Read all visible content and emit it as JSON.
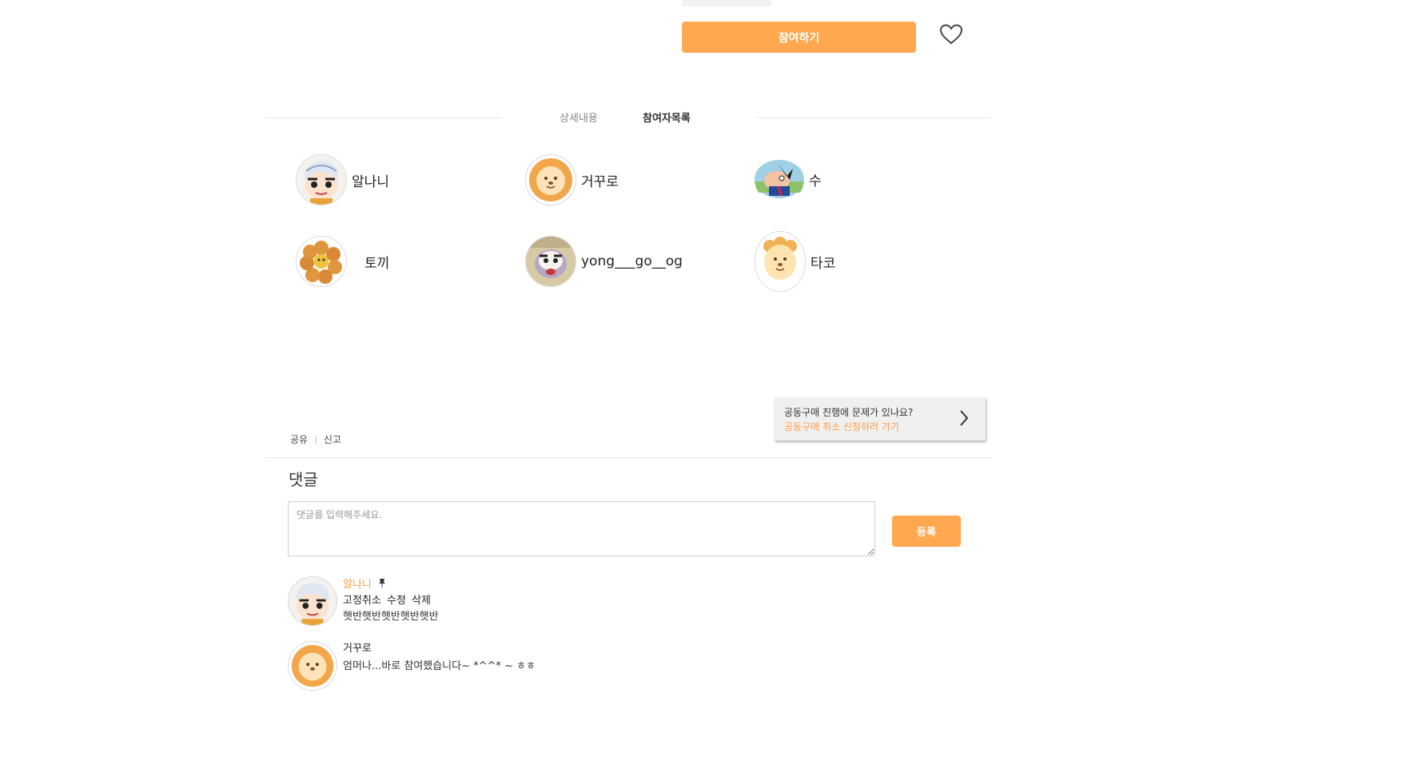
{
  "actions": {
    "join_label": "참여하기",
    "wishlist_icon": "heart-outline-icon"
  },
  "tabs": [
    {
      "label": "상세내용",
      "active": false
    },
    {
      "label": "참여자목록",
      "active": true
    }
  ],
  "members": [
    {
      "name": "알나니",
      "avatar": "boy-character-avatar"
    },
    {
      "name": "거꾸로",
      "avatar": "lion-avatar"
    },
    {
      "name": "수",
      "avatar": "cartoon-man-avatar"
    },
    {
      "name": "토끼",
      "avatar": "donut-avatar"
    },
    {
      "name": "yong___go__og",
      "avatar": "dog-character-avatar"
    },
    {
      "name": "타코",
      "avatar": "lion-avatar"
    }
  ],
  "links": {
    "share": "공유",
    "separator": "|",
    "report": "신고"
  },
  "cancel_notice": {
    "question": "공동구매 진행에 문제가 있나요?",
    "link": "공동구매 취소 신청하러 가기"
  },
  "comments_section": {
    "title": "댓글",
    "input_placeholder": "댓글를 입력해주세요.",
    "submit_label": "등록"
  },
  "comments": [
    {
      "author": "알나니",
      "pinned": true,
      "pin_icon": "pin-icon",
      "actions": [
        "고정취소",
        "수정",
        "삭제"
      ],
      "text": "햇반햇반햇반햇반햇반"
    },
    {
      "author": "거꾸로",
      "pinned": false,
      "text": "엄머나...바로 참여했습니다~ *^^* ~ ㅎㅎ"
    }
  ],
  "colors": {
    "accent": "#ffa84f",
    "accent_text": "#ff9d43"
  }
}
